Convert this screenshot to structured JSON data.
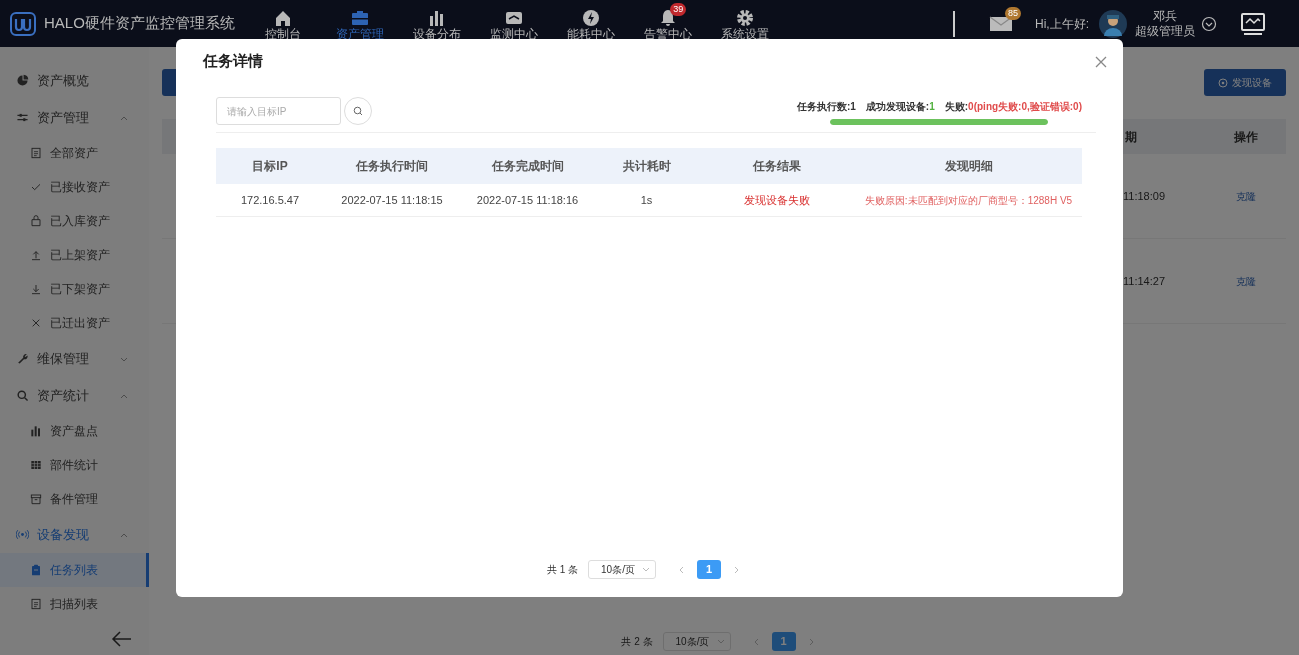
{
  "app": {
    "title": "HALO硬件资产监控管理系统"
  },
  "nav": [
    {
      "label": "控制台",
      "kind": "home",
      "selected": false
    },
    {
      "label": "资产管理",
      "kind": "box",
      "selected": true
    },
    {
      "label": "设备分布",
      "kind": "bars",
      "selected": false
    },
    {
      "label": "监测中心",
      "kind": "monitor",
      "selected": false
    },
    {
      "label": "能耗中心",
      "kind": "bolt",
      "selected": false
    },
    {
      "label": "告警中心",
      "kind": "bell",
      "selected": false,
      "badge": "39"
    },
    {
      "label": "系统设置",
      "kind": "gear",
      "selected": false
    }
  ],
  "user": {
    "mail_badge": "85",
    "greeting": "Hi,上午好:",
    "name": "邓兵",
    "role": "超级管理员"
  },
  "sidebar": [
    {
      "label": "资产概览",
      "kind": "pie",
      "selected": false
    },
    {
      "label": "资产管理",
      "kind": "sliders",
      "selected": false,
      "expanded": true,
      "children": [
        {
          "label": "全部资产",
          "kind": "doc",
          "selected": false
        },
        {
          "label": "已接收资产",
          "kind": "check",
          "selected": false
        },
        {
          "label": "已入库资产",
          "kind": "bag",
          "selected": false
        },
        {
          "label": "已上架资产",
          "kind": "up",
          "selected": false
        },
        {
          "label": "已下架资产",
          "kind": "down",
          "selected": false
        },
        {
          "label": "已迁出资产",
          "kind": "x",
          "selected": false
        }
      ]
    },
    {
      "label": "维保管理",
      "kind": "wrench",
      "selected": false,
      "expanded": false
    },
    {
      "label": "资产统计",
      "kind": "search",
      "selected": false,
      "expanded": true,
      "children": [
        {
          "label": "资产盘点",
          "kind": "bars",
          "selected": false
        },
        {
          "label": "部件统计",
          "kind": "grid",
          "selected": false
        },
        {
          "label": "备件管理",
          "kind": "archive",
          "selected": false
        }
      ]
    },
    {
      "label": "设备发现",
      "kind": "signal",
      "selected": true,
      "expanded": true,
      "children": [
        {
          "label": "任务列表",
          "kind": "clip",
          "selected": true
        },
        {
          "label": "扫描列表",
          "kind": "doc",
          "selected": false
        }
      ]
    }
  ],
  "background": {
    "discover_button": "发现设备",
    "table": {
      "columns": [
        "期",
        "操作"
      ],
      "rows": [
        [
          "11:18:09",
          "克隆"
        ],
        [
          "11:14:27",
          "克隆"
        ]
      ]
    },
    "pagination": {
      "total": "共 2 条",
      "page_size": "10条/页",
      "pages": [
        {
          "label": "1",
          "selected": true
        }
      ]
    }
  },
  "dialog": {
    "title": "任务详情",
    "search": {
      "placeholder": "请输入目标IP"
    },
    "stats": [
      {
        "label": "任务执行数:",
        "value": "1",
        "kind": "total"
      },
      {
        "label": "成功发现设备:",
        "value": "1",
        "kind": "success"
      },
      {
        "label": "失败:",
        "value": "0(ping失败:0,验证错误:0)",
        "kind": "failure"
      }
    ],
    "progress": {
      "level": 1
    },
    "table": {
      "columns": [
        "目标IP",
        "任务执行时间",
        "任务完成时间",
        "共计耗时",
        "任务结果",
        "发现明细"
      ],
      "rows": [
        {
          "cells": [
            "172.16.5.47",
            "2022-07-15 11:18:15",
            "2022-07-15 11:18:16",
            "1s",
            "发现设备失败",
            "失败原因:未匹配到对应的厂商型号：1288H V5"
          ],
          "failed": true
        }
      ]
    },
    "pagination": {
      "total": "共 1 条",
      "page_size": "10条/页",
      "pages": [
        {
          "label": "1",
          "selected": true
        }
      ]
    }
  }
}
